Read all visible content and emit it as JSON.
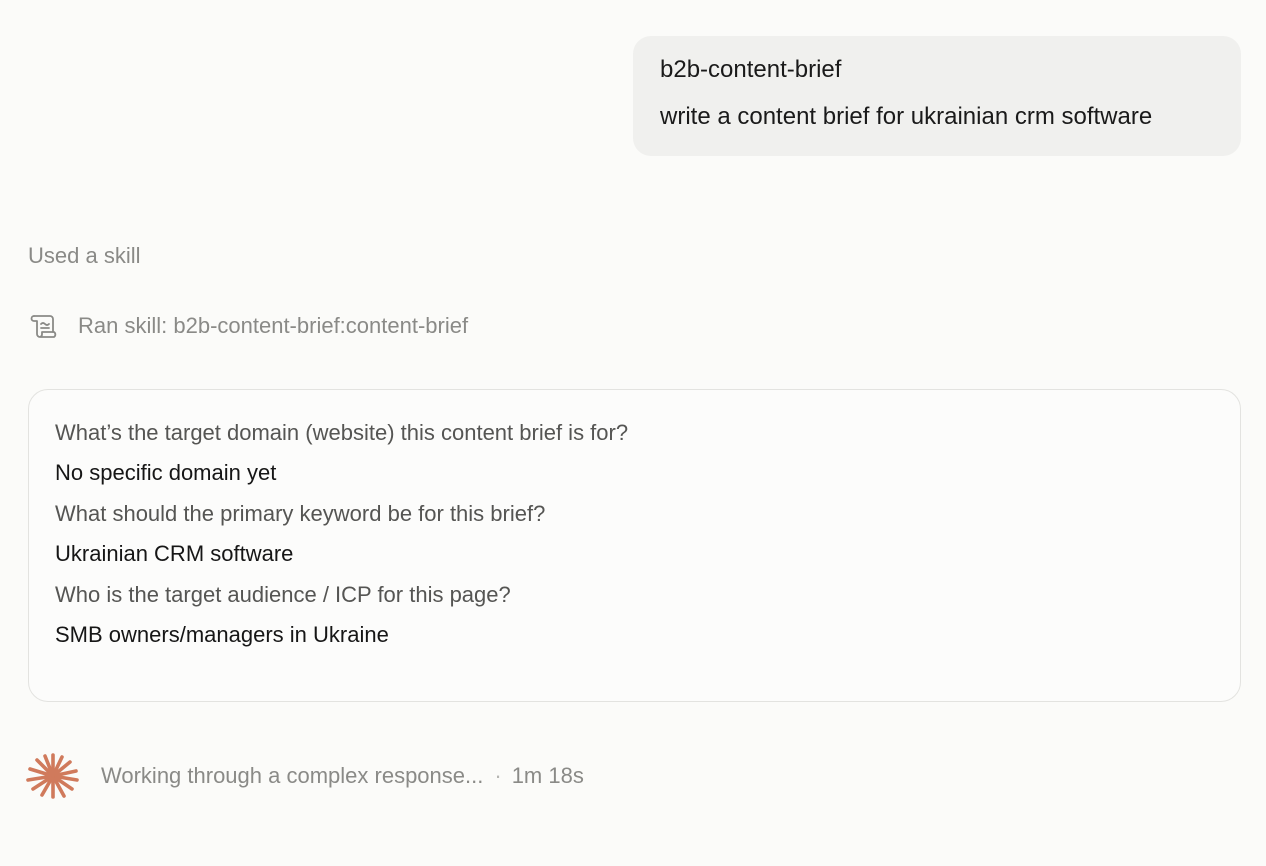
{
  "user_message": {
    "skill_name": "b2b-content-brief",
    "prompt": "write a content brief for ukrainian crm software"
  },
  "skill_section": {
    "header": "Used a skill",
    "ran_skill_label": "Ran skill: b2b-content-brief:content-brief",
    "icon": "scroll-icon"
  },
  "qa_card": {
    "items": [
      {
        "question": "What’s the target domain (website) this content brief is for?",
        "answer": "No specific domain yet"
      },
      {
        "question": "What should the primary keyword be for this brief?",
        "answer": "Ukrainian CRM software"
      },
      {
        "question": "Who is the target audience / ICP for this page?",
        "answer": "SMB owners/managers in Ukraine"
      }
    ]
  },
  "status": {
    "text": "Working through a complex response...",
    "separator": "·",
    "elapsed": "1m 18s",
    "icon": "spark-icon",
    "accent_color": "#d07a5c"
  }
}
